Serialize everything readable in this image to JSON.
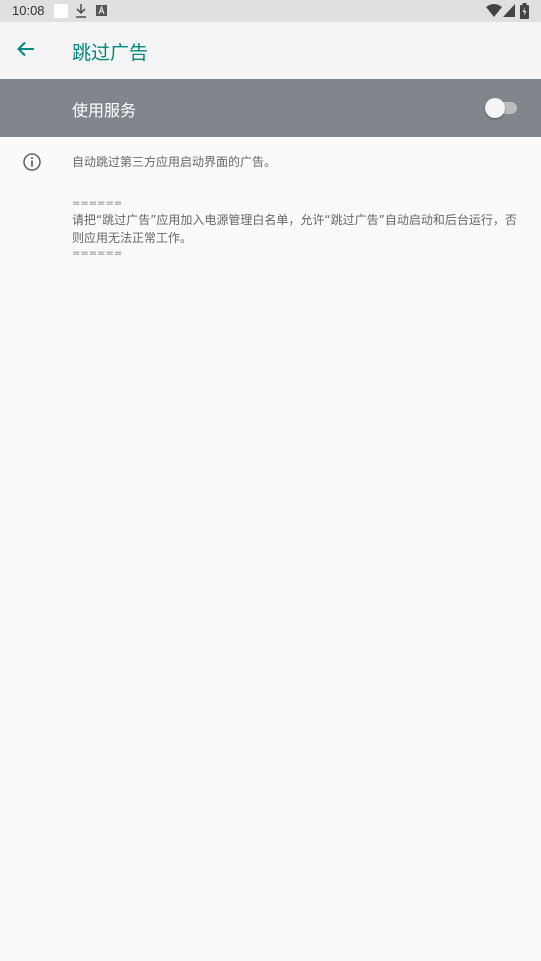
{
  "status_bar": {
    "time": "10:08",
    "icons": [
      "notification-square-icon",
      "download-icon",
      "a-badge-icon",
      "wifi-icon",
      "cell-signal-icon",
      "battery-icon"
    ]
  },
  "app_bar": {
    "back_icon": "arrow-left-icon",
    "title": "跳过广告",
    "accent_color": "#00897b"
  },
  "service": {
    "label": "使用服务",
    "enabled": false,
    "bar_color": "#80868b"
  },
  "info": {
    "icon": "info-circle-icon",
    "description": "自动跳过第三方应用启动界面的广告。",
    "note_separator_top": "======",
    "note_body": "请把“跳过广告”应用加入电源管理白名单，允许“跳过广告”自动启动和后台运行，否则应用无法正常工作。",
    "note_separator_bottom": "======"
  }
}
